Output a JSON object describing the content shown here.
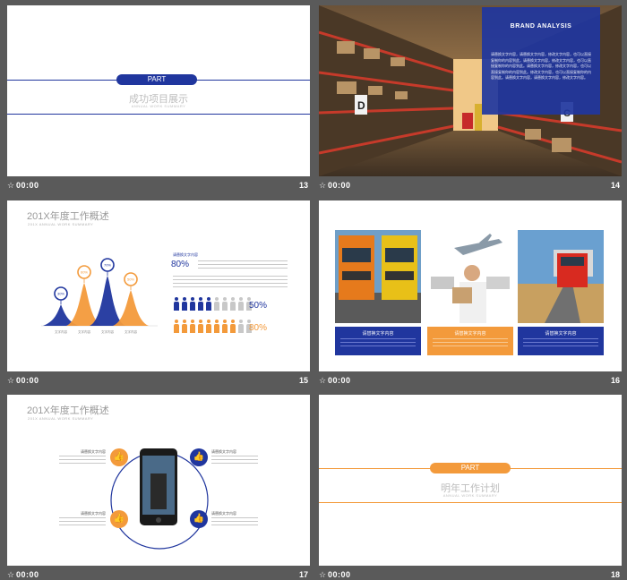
{
  "colors": {
    "blue": "#20369e",
    "orange": "#f39a3b",
    "dark_bg": "#5a5a5a"
  },
  "footers": [
    {
      "time": "00:00",
      "num": "13"
    },
    {
      "time": "00:00",
      "num": "14"
    },
    {
      "time": "00:00",
      "num": "15"
    },
    {
      "time": "00:00",
      "num": "16"
    },
    {
      "time": "00:00",
      "num": "17"
    },
    {
      "time": "00:00",
      "num": "18"
    }
  ],
  "slide13": {
    "pill": "PART",
    "title": "成功项目展示",
    "subtitle": "ANNUAL WORK SUMMARY"
  },
  "slide14": {
    "box_title": "BRAND ANALYSIS",
    "box_text": "请替换文字内容，请替换文字内容，修改文字内容，也可以直接复制你的内容到此，请替换文字内容，修改文字内容，也可以直接复制你的内容到此。请替换文字内容，修改文字内容，也可以直接复制你的内容到此。修改文字内容，也可以直接复制你的内容到此。请替换文字内容，请替换文字内容，修改文字内容。"
  },
  "slide15": {
    "title": "201X年度工作概述",
    "subtitle": "201X ANNUAL WORK SUMMARY",
    "chart_data": {
      "type": "area",
      "categories": [
        "文字内容",
        "文字内容",
        "文字内容",
        "文字内容"
      ],
      "values": [
        30,
        60,
        70,
        50
      ],
      "markers": [
        "30%",
        "60%",
        "70%",
        "50%"
      ]
    },
    "right_heading": "请替换文字内容",
    "stat1": "80%",
    "people_stat_1": "50%",
    "people_stat_2": "80%"
  },
  "slide16": {
    "captions": [
      {
        "title": "请替换文字内容"
      },
      {
        "title": "请替换文字内容"
      },
      {
        "title": "请替换文字内容"
      }
    ]
  },
  "slide17": {
    "title": "201X年度工作概述",
    "subtitle": "201X ANNUAL WORK SUMMARY",
    "labels": [
      "请替换文字内容",
      "请替换文字内容",
      "请替换文字内容",
      "请替换文字内容"
    ]
  },
  "slide18": {
    "pill": "PART",
    "title": "明年工作计划",
    "subtitle": "ANNUAL WORK SUMMARY"
  }
}
